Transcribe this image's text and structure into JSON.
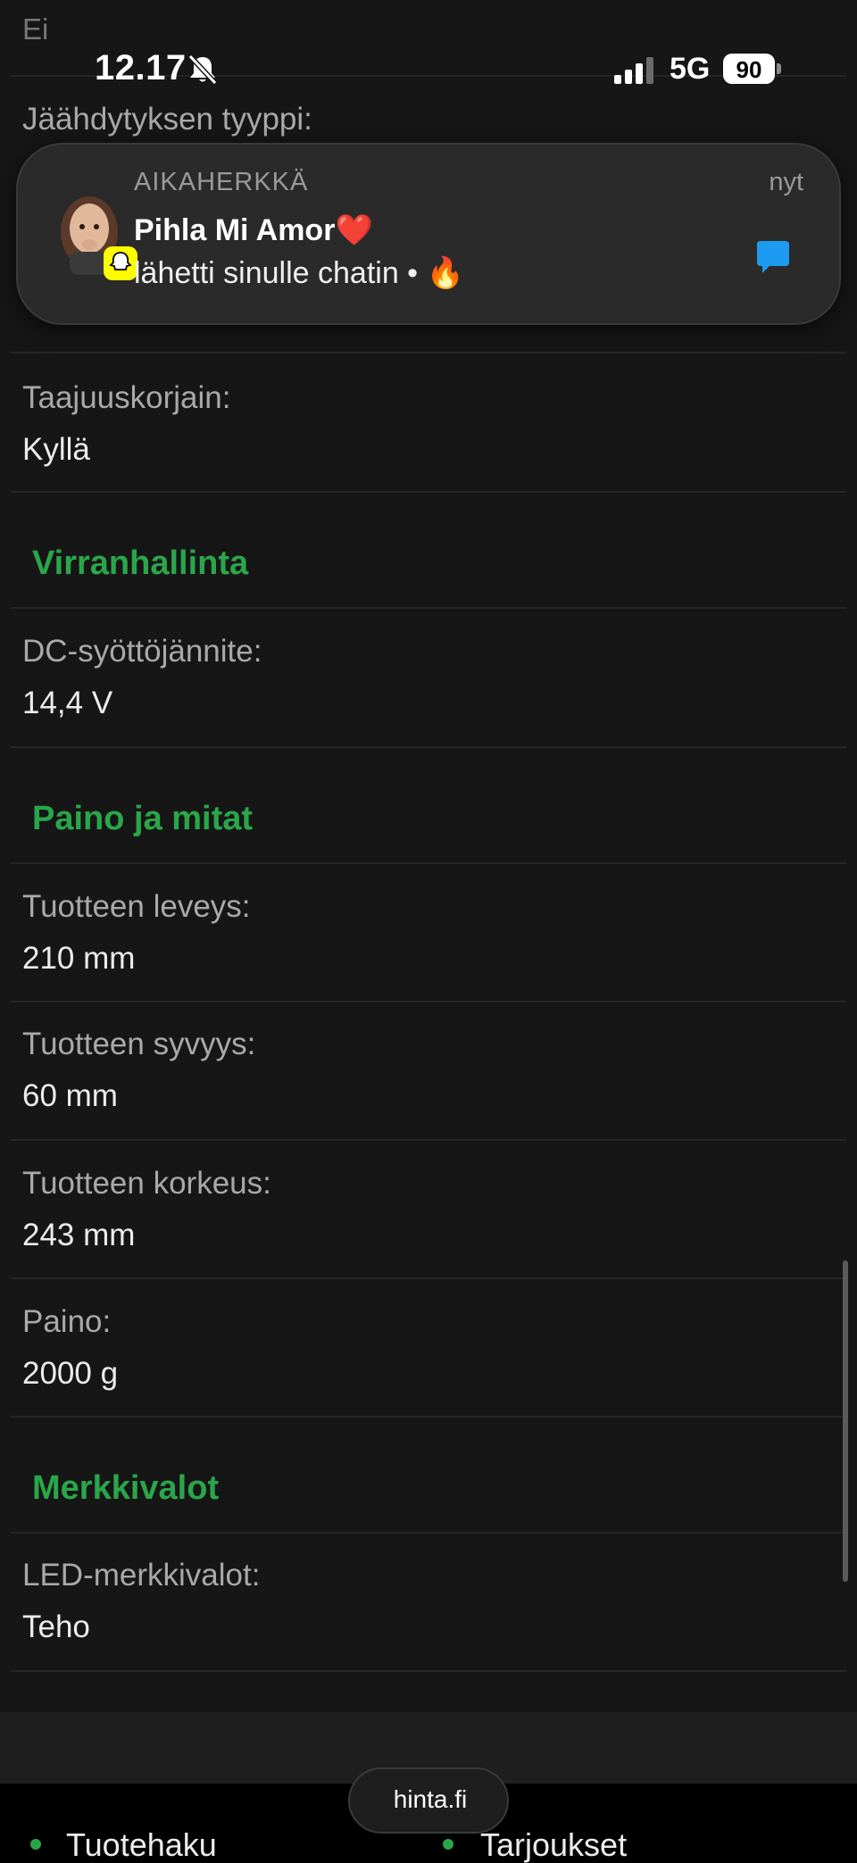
{
  "status_bar": {
    "time": "12.17",
    "network": "5G",
    "battery": "90"
  },
  "notification": {
    "app_tag": "AIKAHERKKÄ",
    "time": "nyt",
    "title": "Pihla Mi Amor",
    "title_emoji": "❤️",
    "body": "lähetti sinulle chatin •",
    "body_emoji": "🔥"
  },
  "specs": {
    "prev_value": "Ei",
    "cooling_label": "Jäähdytyksen tyyppi:",
    "equalizer": {
      "label": "Taajuuskorjain:",
      "value": "Kyllä"
    },
    "section_power": "Virranhallinta",
    "dc_voltage": {
      "label": "DC-syöttöjännite:",
      "value": "14,4 V"
    },
    "section_dimensions": "Paino ja mitat",
    "width": {
      "label": "Tuotteen leveys:",
      "value": "210 mm"
    },
    "depth": {
      "label": "Tuotteen syvyys:",
      "value": "60 mm"
    },
    "height": {
      "label": "Tuotteen korkeus:",
      "value": "243 mm"
    },
    "weight": {
      "label": "Paino:",
      "value": "2000 g"
    },
    "section_lights": "Merkkivalot",
    "led": {
      "label": "LED-merkkivalot:",
      "value": "Teho"
    }
  },
  "browser": {
    "url": "hinta.fi"
  },
  "bottom_nav": {
    "item1": "Tuotehaku",
    "item2": "Tarjoukset"
  }
}
